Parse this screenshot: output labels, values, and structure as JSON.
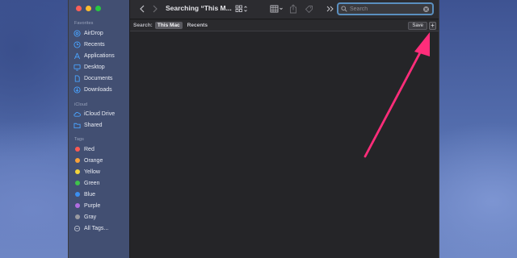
{
  "window": {
    "title": "Searching “This M...",
    "traffic_lights": [
      "close",
      "minimize",
      "zoom"
    ]
  },
  "sidebar": {
    "favorites_heading": "Favorites",
    "favorites": [
      {
        "label": "AirDrop",
        "icon": "airdrop-icon"
      },
      {
        "label": "Recents",
        "icon": "clock-icon"
      },
      {
        "label": "Applications",
        "icon": "applications-icon"
      },
      {
        "label": "Desktop",
        "icon": "desktop-icon"
      },
      {
        "label": "Documents",
        "icon": "document-icon"
      },
      {
        "label": "Downloads",
        "icon": "download-icon"
      }
    ],
    "icloud_heading": "iCloud",
    "icloud": [
      {
        "label": "iCloud Drive",
        "icon": "cloud-icon"
      },
      {
        "label": "Shared",
        "icon": "shared-folder-icon"
      }
    ],
    "tags_heading": "Tags",
    "tags": [
      {
        "label": "Red",
        "color": "#ff5a52"
      },
      {
        "label": "Orange",
        "color": "#f7a13a"
      },
      {
        "label": "Yellow",
        "color": "#f3d33c"
      },
      {
        "label": "Green",
        "color": "#3fc24b"
      },
      {
        "label": "Blue",
        "color": "#3b8ff0"
      },
      {
        "label": "Purple",
        "color": "#b06de0"
      },
      {
        "label": "Gray",
        "color": "#9a9aa0"
      },
      {
        "label": "All Tags...",
        "icon": "all-tags-icon"
      }
    ]
  },
  "toolbar": {
    "back_icon": "chevron-left-icon",
    "forward_icon": "chevron-right-icon",
    "view_icon": "grid-view-icon",
    "group_icon": "group-icon",
    "share_icon": "share-icon",
    "tag_icon": "tag-icon",
    "more_icon": "double-chevron-icon"
  },
  "search": {
    "placeholder": "Search",
    "value": ""
  },
  "scope_bar": {
    "label": "Search:",
    "options": [
      "This Mac",
      "Recents"
    ],
    "selected": "This Mac",
    "save_label": "Save",
    "add_label": "+"
  },
  "annotation": {
    "color": "#ff2d7a"
  },
  "colors": {
    "accent": "#5a8fbf"
  }
}
